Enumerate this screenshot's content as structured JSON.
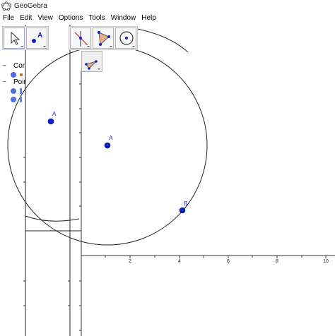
{
  "window": {
    "title": "GeoGebra"
  },
  "menu": [
    "File",
    "Edit",
    "View",
    "Options",
    "Tools",
    "Window",
    "Help"
  ],
  "algebra": {
    "group1_label": "Cor",
    "group2_label": "Poir"
  },
  "canvas": {
    "x_ticks": [
      "2",
      "4",
      "6",
      "8",
      "10"
    ],
    "points": {
      "A_main": "A",
      "A_left": "A",
      "B": "B"
    }
  },
  "toolbar": {
    "tools_left": [
      "move-tool",
      "point-tool"
    ],
    "tools_right": [
      "perpendicular-line-tool",
      "polygon-tool",
      "circle-tool"
    ],
    "popup": [
      "close",
      "rigid-polygon-tool"
    ]
  },
  "colors": {
    "point": "#1020c8",
    "line": "#000000",
    "algebra_dot": "#4f6fe0"
  }
}
